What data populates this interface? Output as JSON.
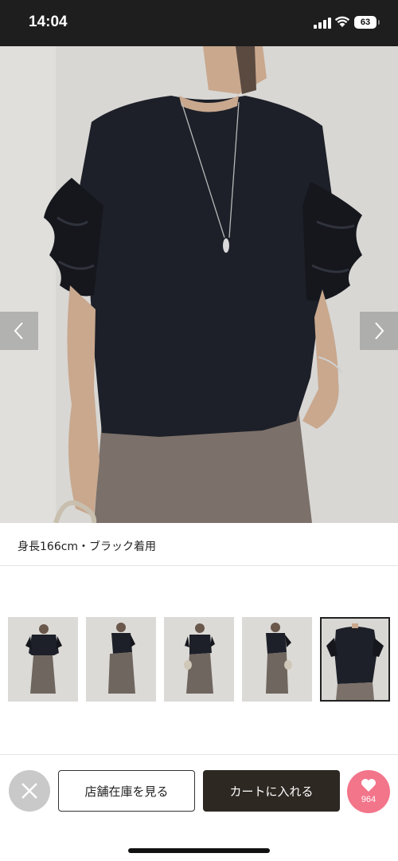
{
  "status_bar": {
    "time": "14:04",
    "battery": "63",
    "icons": [
      "signal-icon",
      "wifi-icon",
      "battery-icon"
    ]
  },
  "product": {
    "caption": "身長166cm・ブラック着用",
    "main_photo": "model-wearing-black-ruffle-sleeve-top-photo",
    "thumbnails_count_visible": 5,
    "selected_thumbnail_index": 4
  },
  "actions": {
    "store_stock_label": "店舗在庫を見る",
    "add_to_cart_label": "カートに入れる",
    "like_count": "964"
  },
  "colors": {
    "status_bar_bg": "#1e1e1e",
    "cart_button_bg": "#2d2822",
    "like_button_bg": "#f2758a",
    "close_button_bg": "#c9c9c9"
  }
}
